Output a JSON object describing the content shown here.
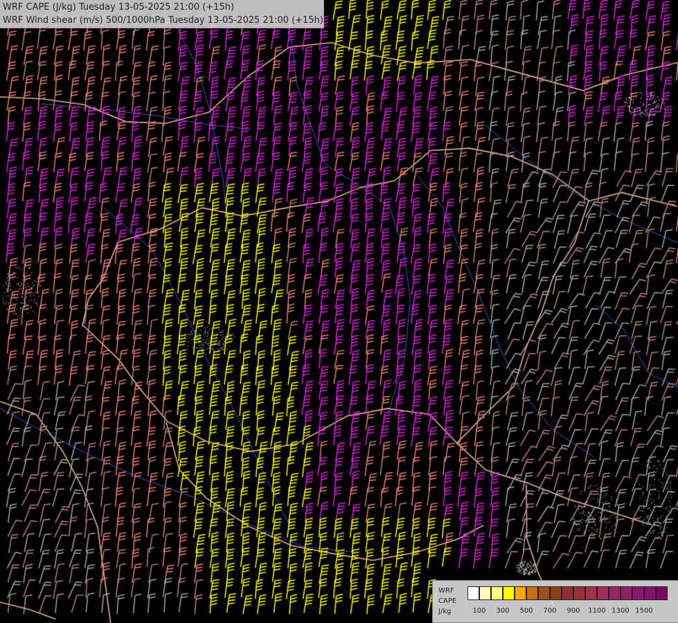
{
  "header": {
    "line1": "WRF CAPE (J/kg) Tuesday 13-05-2025 21:00 (+15h)",
    "line2": "WRF Wind shear (m/s) 500/1000hPa Tuesday 13-05-2025 21:00 (+15h)"
  },
  "legend": {
    "label_model": "WRF",
    "label_field": "CAPE",
    "label_unit": "J/kg",
    "colors": [
      "#ffffff",
      "#ffffc0",
      "#ffff80",
      "#ffff00",
      "#ffa500",
      "#c87010",
      "#a05018",
      "#8c4018",
      "#8c3030",
      "#9a3038",
      "#a03048",
      "#a02c58",
      "#9a2860",
      "#901e68",
      "#8a1870",
      "#8a1070",
      "#7a0a60"
    ],
    "tick_labels": [
      "100",
      "300",
      "500",
      "700",
      "900",
      "1100",
      "1300",
      "1500"
    ]
  },
  "map": {
    "description_colors": {
      "background": "#000000",
      "border": "#e6b49a",
      "river": "#3a5fd0",
      "barb_low": "#a8a8a8",
      "barb_mid": "#c08080",
      "barb_salmon": "#f08070",
      "barb_magenta": "#e020e0",
      "barb_yellow": "#ffff00"
    }
  }
}
